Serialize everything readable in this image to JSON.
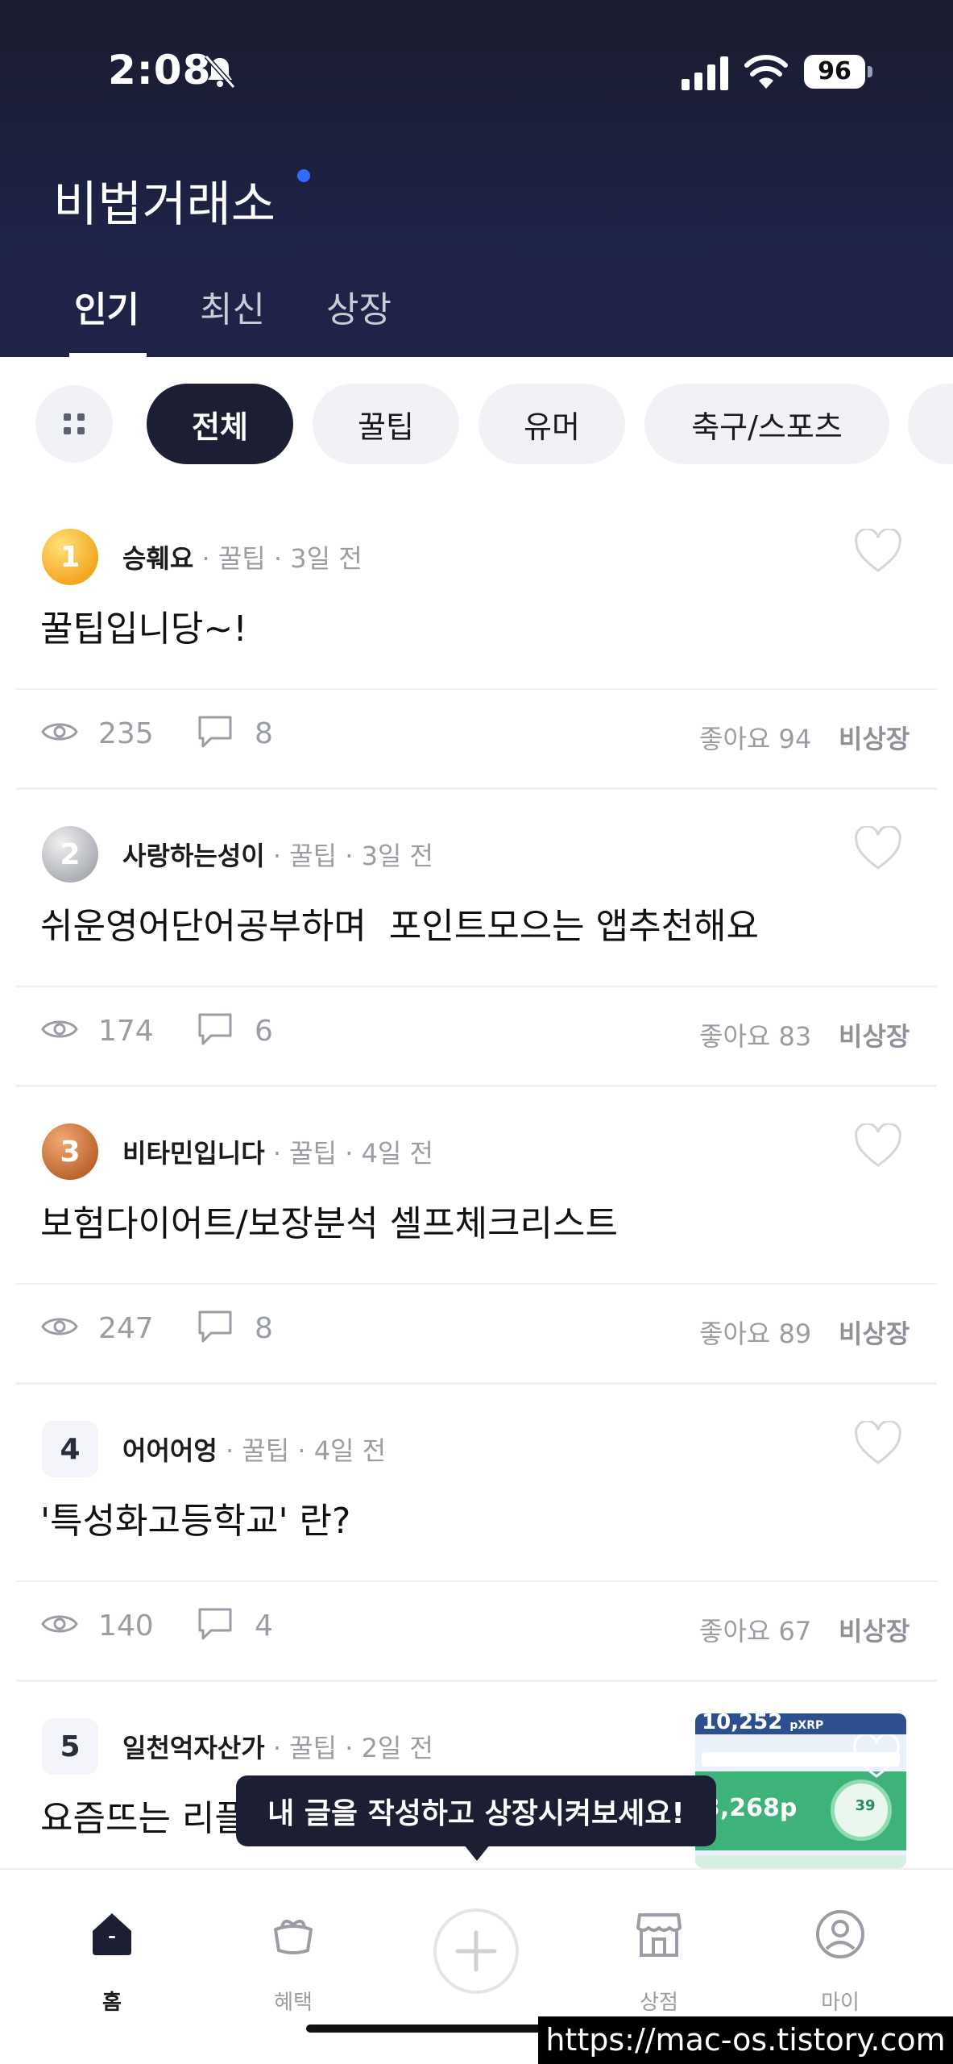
{
  "status_bar": {
    "time": "2:08",
    "battery": "96"
  },
  "app": {
    "title": "비법거래소"
  },
  "tabs": [
    {
      "label": "인기",
      "active": true
    },
    {
      "label": "최신",
      "active": false
    },
    {
      "label": "상장",
      "active": false
    }
  ],
  "categories": [
    {
      "label": "전체",
      "active": true
    },
    {
      "label": "꿀팁",
      "active": false
    },
    {
      "label": "유머",
      "active": false
    },
    {
      "label": "축구/스포츠",
      "active": false
    }
  ],
  "posts": [
    {
      "rank": "1",
      "author": "승훼요",
      "category": "꿀팁",
      "time": "3일 전",
      "title": "꿀팁입니당~!",
      "views": "235",
      "comments": "8",
      "likes": "좋아요 94",
      "status": "비상장"
    },
    {
      "rank": "2",
      "author": "사랑하는성이",
      "category": "꿀팁",
      "time": "3일 전",
      "title": "쉬운영어단어공부하며  포인트모으는 앱추천해요",
      "views": "174",
      "comments": "6",
      "likes": "좋아요 83",
      "status": "비상장"
    },
    {
      "rank": "3",
      "author": "비타민입니다",
      "category": "꿀팁",
      "time": "4일 전",
      "title": "보험다이어트/보장분석 셀프체크리스트",
      "views": "247",
      "comments": "8",
      "likes": "좋아요 89",
      "status": "비상장"
    },
    {
      "rank": "4",
      "author": "어어어엉",
      "category": "꿀팁",
      "time": "4일 전",
      "title": "'특성화고등학교' 란?",
      "views": "140",
      "comments": "4",
      "likes": "좋아요 67",
      "status": "비상장"
    },
    {
      "rank": "5",
      "author": "일천억자산가",
      "category": "꿀팁",
      "time": "2일 전",
      "title": "요즘뜨는 리플",
      "thumb": {
        "big": "10,252",
        "unit": "pXRP",
        "points": "3,268p",
        "gauge": "39"
      }
    }
  ],
  "tooltip": {
    "text": "내 글을 작성하고 상장시켜보세요!"
  },
  "bottom_nav": [
    {
      "label": "홈",
      "icon": "home-icon",
      "active": true
    },
    {
      "label": "혜택",
      "icon": "gift-icon",
      "active": false
    },
    {
      "label": "",
      "icon": "plus-icon",
      "active": false
    },
    {
      "label": "상점",
      "icon": "store-icon",
      "active": false
    },
    {
      "label": "마이",
      "icon": "profile-icon",
      "active": false
    }
  ],
  "watermark": "https://mac-os.tistory.com",
  "colors": {
    "header": "#1d2142",
    "accent_dot": "#2f6bff",
    "chip_active": "#1c1f33"
  }
}
